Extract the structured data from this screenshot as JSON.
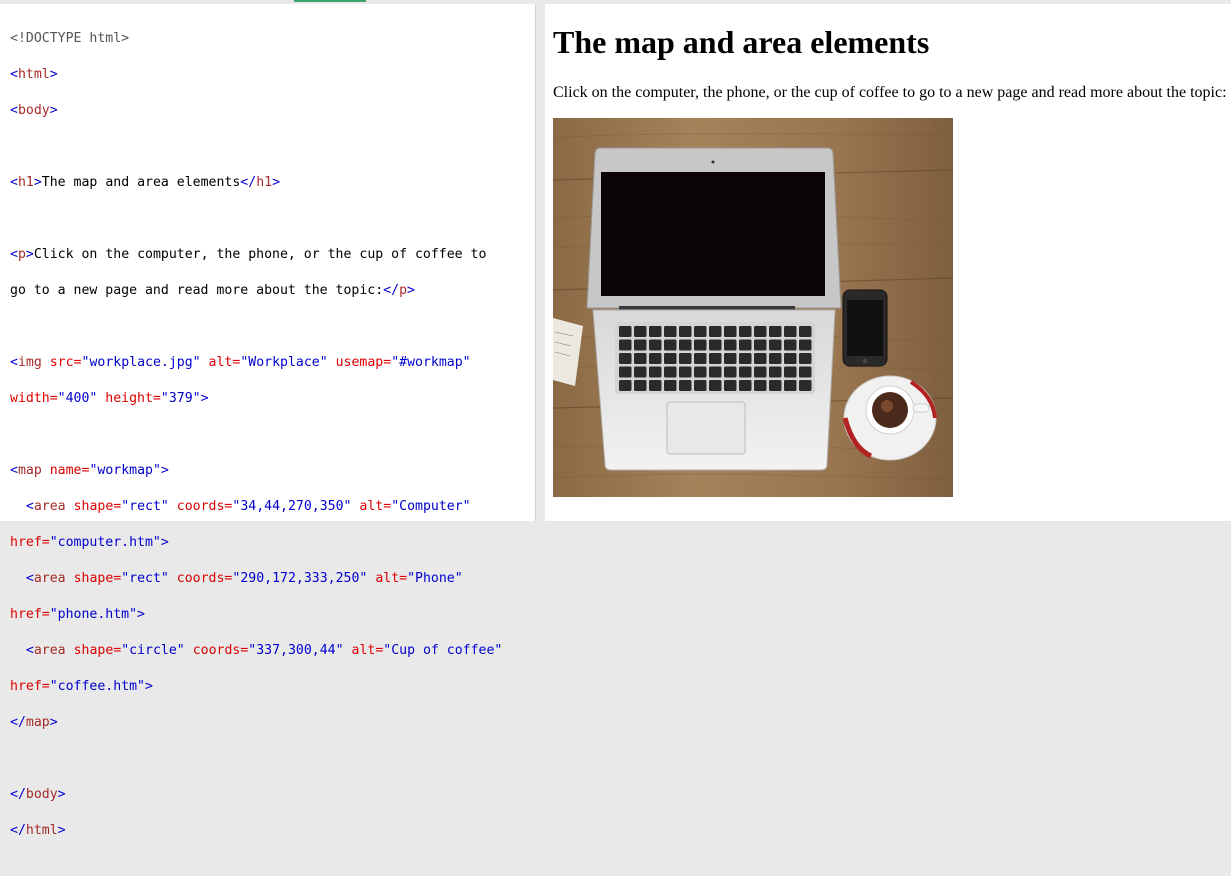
{
  "code": {
    "doctype": "<!DOCTYPE html>",
    "html_open": "html",
    "body_open": "body",
    "h1_text": "The map and area elements",
    "p_text_1": "Click on the computer, the phone, or the cup of coffee to",
    "p_text_2": "go to a new page and read more about the topic:",
    "img_src": "\"workplace.jpg\"",
    "img_alt": "\"Workplace\"",
    "img_usemap": "\"#workmap\"",
    "img_width": "\"400\"",
    "img_height": "\"379\"",
    "map_name": "\"workmap\"",
    "area1_shape": "\"rect\"",
    "area1_coords": "\"34,44,270,350\"",
    "area1_alt": "\"Computer\"",
    "area1_href": "\"computer.htm\"",
    "area2_shape": "\"rect\"",
    "area2_coords": "\"290,172,333,250\"",
    "area2_alt": "\"Phone\"",
    "area2_href": "\"phone.htm\"",
    "area3_shape": "\"circle\"",
    "area3_coords": "\"337,300,44\"",
    "area3_alt": "\"Cup of coffee\"",
    "area3_href": "\"coffee.htm\""
  },
  "result": {
    "heading": "The map and area elements",
    "paragraph": "Click on the computer, the phone, or the cup of coffee to go to a new page and read more about the topic:",
    "image_alt": "Workplace"
  },
  "colors": {
    "tag": "#a52a2a",
    "attribute": "#dd0000",
    "value": "#0000cd",
    "accent": "#3ea36b"
  }
}
